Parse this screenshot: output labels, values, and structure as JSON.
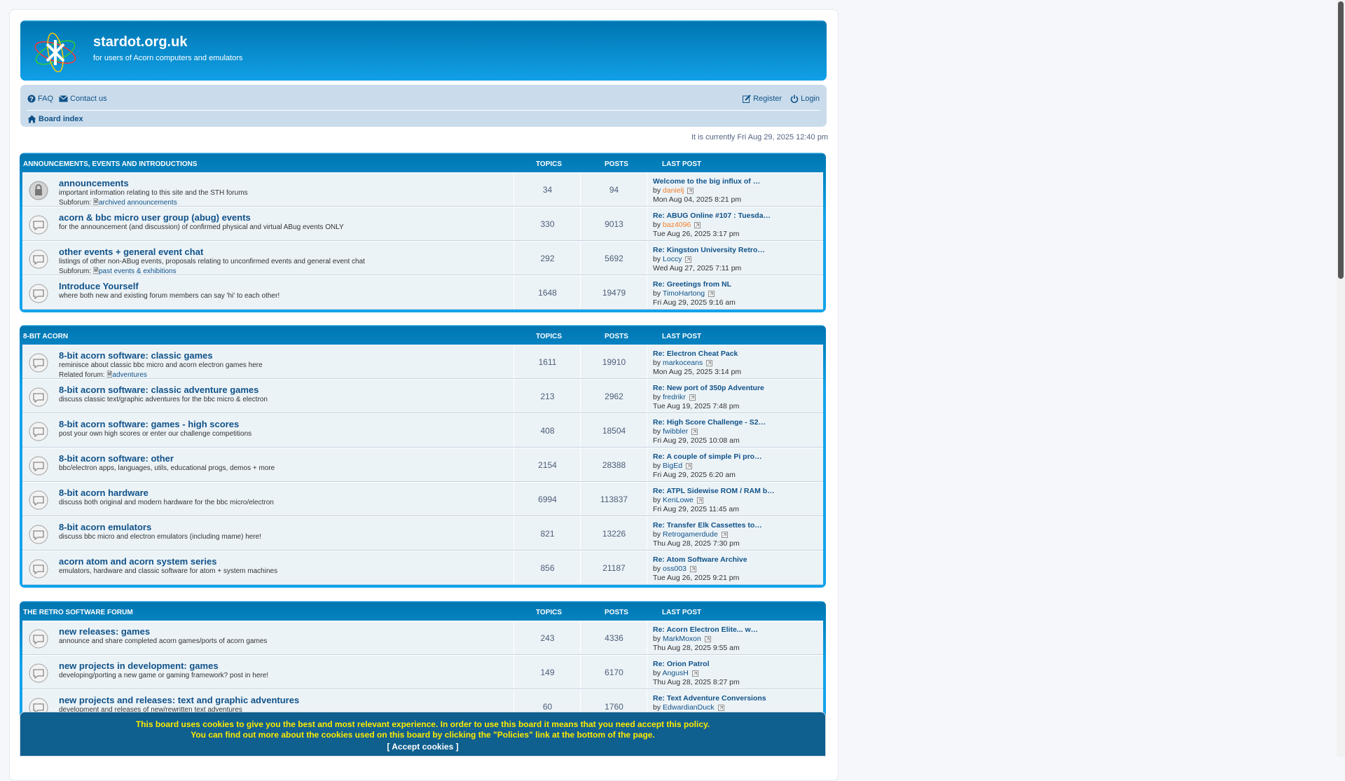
{
  "site": {
    "title": "stardot.org.uk",
    "description": "for users of Acorn computers and emulators"
  },
  "nav": {
    "faq": "FAQ",
    "contact": "Contact us",
    "register": "Register",
    "login": "Login",
    "board_index": "Board index"
  },
  "time": "It is currently Fri Aug 29, 2025 12:40 pm",
  "headers": {
    "topics": "TOPICS",
    "posts": "POSTS",
    "last_post": "LAST POST"
  },
  "categories": [
    {
      "title": "ANNOUNCEMENTS, EVENTS AND INTRODUCTIONS",
      "forums": [
        {
          "title": "announcements",
          "desc": "important information relating to this site and the STH forums",
          "sub_label": "Subforum:",
          "sub": "archived announcements",
          "topics": "34",
          "posts": "94",
          "lp_title": "Welcome to the big influx of …",
          "lp_by": "by",
          "lp_user": "danielj",
          "lp_date": "Mon Aug 04, 2025 8:21 pm"
        },
        {
          "title": "acorn & bbc micro user group (abug) events",
          "desc": "for the announcement (and discussion) of confirmed physical and virtual ABug events ONLY",
          "sub_label": "",
          "sub": "",
          "topics": "330",
          "posts": "9013",
          "lp_title": "Re: ABUG Online #107 : Tuesda…",
          "lp_by": "by",
          "lp_user": "baz4096",
          "lp_date": "Tue Aug 26, 2025 3:17 pm"
        },
        {
          "title": "other events + general event chat",
          "desc": "listings of other non-ABug events, proposals relating to unconfirmed events and general event chat",
          "sub_label": "Subforum:",
          "sub": "past events & exhibitions",
          "topics": "292",
          "posts": "5692",
          "lp_title": "Re: Kingston University Retro…",
          "lp_by": "by",
          "lp_user": "Loccy",
          "lp_date": "Wed Aug 27, 2025 7:11 pm"
        },
        {
          "title": "Introduce Yourself",
          "desc": "where both new and existing forum members can say 'hi' to each other!",
          "sub_label": "",
          "sub": "",
          "topics": "1648",
          "posts": "19479",
          "lp_title": "Re: Greetings from NL",
          "lp_by": "by",
          "lp_user": "TimoHartong",
          "lp_date": "Fri Aug 29, 2025 9:16 am"
        }
      ]
    },
    {
      "title": "8-BIT ACORN",
      "forums": [
        {
          "title": "8-bit acorn software: classic games",
          "desc": "reminisce about classic bbc micro and acorn electron games here",
          "sub_label": "Related forum:",
          "sub": "adventures",
          "topics": "1611",
          "posts": "19910",
          "lp_title": "Re: Electron Cheat Pack",
          "lp_by": "by",
          "lp_user": "markoceans",
          "lp_date": "Mon Aug 25, 2025 3:14 pm"
        },
        {
          "title": "8-bit acorn software: classic adventure games",
          "desc": "discuss classic text/graphic adventures for the bbc micro & electron",
          "sub_label": "",
          "sub": "",
          "topics": "213",
          "posts": "2962",
          "lp_title": "Re: New port of 350p Adventure",
          "lp_by": "by",
          "lp_user": "fredrikr",
          "lp_date": "Tue Aug 19, 2025 7:48 pm"
        },
        {
          "title": "8-bit acorn software: games - high scores",
          "desc": "post your own high scores or enter our challenge competitions",
          "sub_label": "",
          "sub": "",
          "topics": "408",
          "posts": "18504",
          "lp_title": "Re: High Score Challenge - S2…",
          "lp_by": "by",
          "lp_user": "fwibbler",
          "lp_date": "Fri Aug 29, 2025 10:08 am"
        },
        {
          "title": "8-bit acorn software: other",
          "desc": "bbc/electron apps, languages, utils, educational progs, demos + more",
          "sub_label": "",
          "sub": "",
          "topics": "2154",
          "posts": "28388",
          "lp_title": "Re: A couple of simple Pi pro…",
          "lp_by": "by",
          "lp_user": "BigEd",
          "lp_date": "Fri Aug 29, 2025 6:20 am"
        },
        {
          "title": "8-bit acorn hardware",
          "desc": "discuss both original and modern hardware for the bbc micro/electron",
          "sub_label": "",
          "sub": "",
          "topics": "6994",
          "posts": "113837",
          "lp_title": "Re: ATPL Sidewise ROM / RAM b…",
          "lp_by": "by",
          "lp_user": "KenLowe",
          "lp_date": "Fri Aug 29, 2025 11:45 am"
        },
        {
          "title": "8-bit acorn emulators",
          "desc": "discuss bbc micro and electron emulators (including mame) here!",
          "sub_label": "",
          "sub": "",
          "topics": "821",
          "posts": "13226",
          "lp_title": "Re: Transfer Elk Cassettes to…",
          "lp_by": "by",
          "lp_user": "Retrogamerdude",
          "lp_date": "Thu Aug 28, 2025 7:30 pm"
        },
        {
          "title": "acorn atom and acorn system series",
          "desc": "emulators, hardware and classic software for atom + system machines",
          "sub_label": "",
          "sub": "",
          "topics": "856",
          "posts": "21187",
          "lp_title": "Re: Atom Software Archive",
          "lp_by": "by",
          "lp_user": "oss003",
          "lp_date": "Tue Aug 26, 2025 9:21 pm"
        }
      ]
    },
    {
      "title": "THE RETRO SOFTWARE FORUM",
      "forums": [
        {
          "title": "new releases: games",
          "desc": "announce and share completed acorn games/ports of acorn games",
          "sub_label": "",
          "sub": "",
          "topics": "243",
          "posts": "4336",
          "lp_title": "Re: Acorn Electron Elite... w…",
          "lp_by": "by",
          "lp_user": "MarkMoxon",
          "lp_date": "Thu Aug 28, 2025 9:55 am"
        },
        {
          "title": "new projects in development: games",
          "desc": "developing/porting a new game or gaming framework? post in here!",
          "sub_label": "",
          "sub": "",
          "topics": "149",
          "posts": "6170",
          "lp_title": "Re: Orion Patrol",
          "lp_by": "by",
          "lp_user": "AngusH",
          "lp_date": "Thu Aug 28, 2025 8:27 pm"
        },
        {
          "title": "new projects and releases: text and graphic adventures",
          "desc": "development and releases of new/rewritten text adventures",
          "sub_label": "",
          "sub": "",
          "topics": "60",
          "posts": "1760",
          "lp_title": "Re: Text Adventure Conversions",
          "lp_by": "by",
          "lp_user": "EdwardianDuck",
          "lp_date": ""
        }
      ]
    }
  ],
  "cookie": {
    "line1": "This board uses cookies to give you the best and most relevant experience. In order to use this board it means that you need accept this policy.",
    "line2": "You can find out more about the cookies used on this board by clicking the \"Policies\" link at the bottom of the page.",
    "accept": "[ Accept cookies ]"
  },
  "colors": {
    "accent": "#12a3eb",
    "link": "#105289",
    "moderator": "#f47e29",
    "cookie_bg": "#0f5f8f",
    "cookie_text": "#ffea00"
  }
}
